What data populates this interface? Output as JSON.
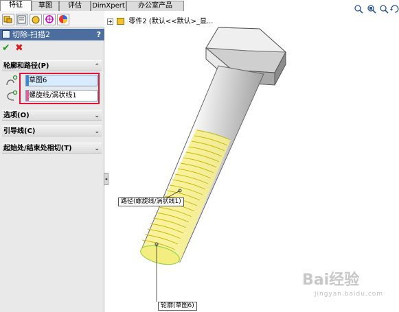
{
  "tabs": [
    {
      "label": "特征",
      "active": true
    },
    {
      "label": "草图",
      "active": false
    },
    {
      "label": "评估",
      "active": false
    },
    {
      "label": "DimXpert",
      "active": false
    },
    {
      "label": "办公室产品",
      "active": false
    }
  ],
  "panel": {
    "feature_title": "切除-扫描2",
    "help": "?",
    "ok_symbol": "✔",
    "cancel_symbol": "✖",
    "groups": {
      "profile_path": {
        "title": "轮廓和路径(P)",
        "profile_value": "草图6",
        "path_value": "螺旋线/涡状线1"
      },
      "options": {
        "title": "选项(O)"
      },
      "guide": {
        "title": "引导线(C)"
      },
      "start_end": {
        "title": "起始处/结束处相切(T)"
      }
    }
  },
  "tree": {
    "expand": "+",
    "text": "零件2  (默认<<默认>_显..."
  },
  "callouts": {
    "path": "路径(螺旋线/涡状线1)",
    "profile": "轮廓(草图6)"
  },
  "watermark": {
    "main": "Bai经验",
    "sub": "jingyan.baidu.com"
  },
  "colors": {
    "title_bar": "#4b6e9e",
    "highlight_box": "#e0143c",
    "thread": "#e8e23a"
  }
}
